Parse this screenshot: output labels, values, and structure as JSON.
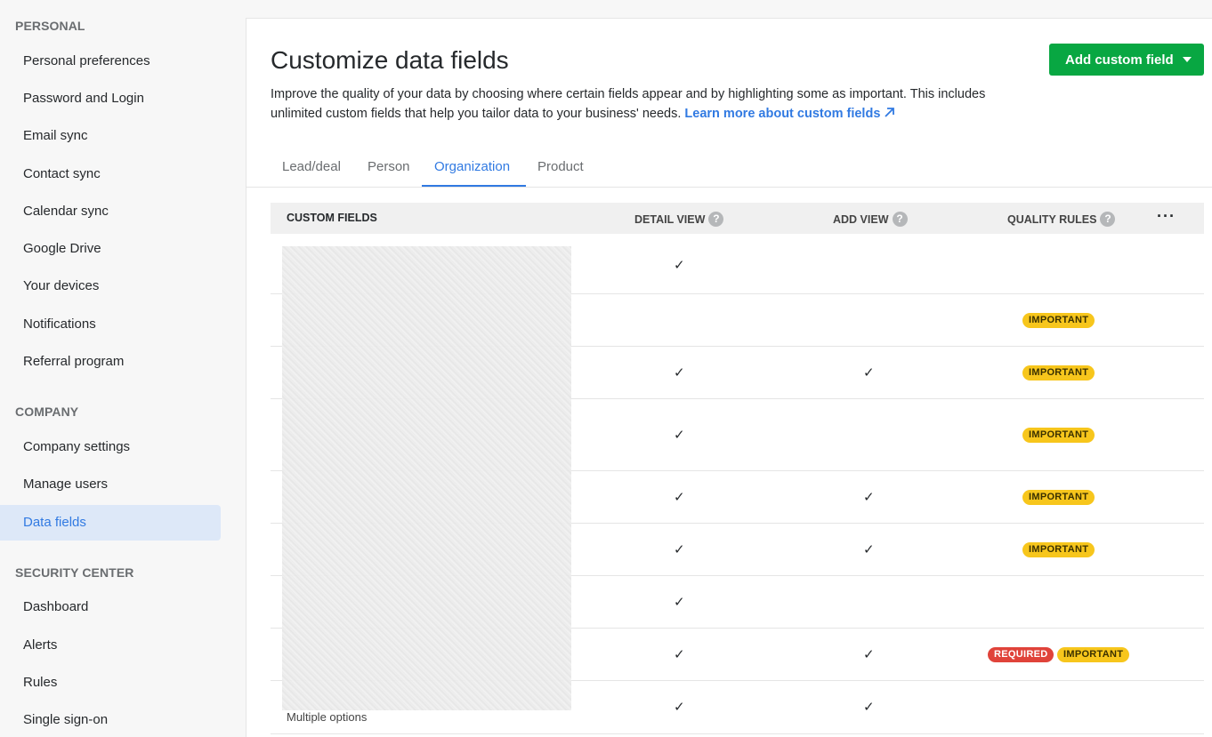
{
  "sidebar": {
    "sections": [
      {
        "title": "PERSONAL",
        "items": [
          "Personal preferences",
          "Password and Login",
          "Email sync",
          "Contact sync",
          "Calendar sync",
          "Google Drive",
          "Your devices",
          "Notifications",
          "Referral program"
        ]
      },
      {
        "title": "COMPANY",
        "items": [
          "Company settings",
          "Manage users",
          "Data fields"
        ]
      },
      {
        "title": "SECURITY CENTER",
        "items": [
          "Dashboard",
          "Alerts",
          "Rules",
          "Single sign-on"
        ]
      }
    ],
    "active_item": "Data fields"
  },
  "header": {
    "title": "Customize data fields",
    "description": "Improve the quality of your data by choosing where certain fields appear and by highlighting some as important. This includes unlimited custom fields that help you tailor data to your business' needs.",
    "learn_more": "Learn more about custom fields",
    "add_button": "Add custom field"
  },
  "tabs": [
    "Lead/deal",
    "Person",
    "Organization",
    "Product"
  ],
  "active_tab": "Organization",
  "table": {
    "columns": {
      "custom_fields": "CUSTOM FIELDS",
      "detail_view": "DETAIL VIEW",
      "add_view": "ADD VIEW",
      "quality_rules": "QUALITY RULES",
      "more": "···"
    },
    "help_glyph": "?",
    "check_glyph": "✓",
    "important_label": "IMPORTANT",
    "required_label": "REQUIRED",
    "rows": [
      {
        "detail": true,
        "add": false,
        "required": false,
        "important": false
      },
      {
        "detail": false,
        "add": false,
        "required": false,
        "important": true
      },
      {
        "detail": true,
        "add": true,
        "required": false,
        "important": true
      },
      {
        "detail": true,
        "add": false,
        "required": false,
        "important": true
      },
      {
        "detail": true,
        "add": true,
        "required": false,
        "important": true
      },
      {
        "detail": true,
        "add": true,
        "required": false,
        "important": true
      },
      {
        "detail": true,
        "add": false,
        "required": false,
        "important": false
      },
      {
        "detail": true,
        "add": true,
        "required": true,
        "important": true
      },
      {
        "detail": true,
        "add": true,
        "required": false,
        "important": false
      }
    ],
    "last_row_type": "Multiple options"
  },
  "colors": {
    "accent": "#317ae2",
    "primary_button": "#08a742",
    "important": "#f7c61c",
    "required": "#e0433a"
  }
}
